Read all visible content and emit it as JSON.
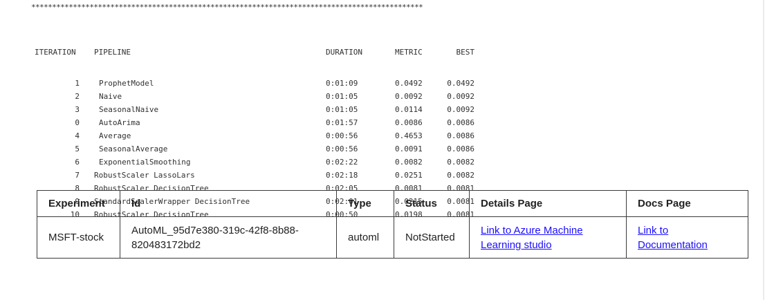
{
  "output": {
    "separator": "**********************************************************************************************",
    "headers": {
      "iteration": "ITERATION",
      "pipeline": "PIPELINE",
      "duration": "DURATION",
      "metric": "METRIC",
      "best": "BEST"
    },
    "runs": [
      {
        "iteration": "1",
        "pipeline": "ProphetModel",
        "duration": "0:01:09",
        "metric": "0.0492",
        "best": "0.0492"
      },
      {
        "iteration": "2",
        "pipeline": "Naive",
        "duration": "0:01:05",
        "metric": "0.0092",
        "best": "0.0092"
      },
      {
        "iteration": "3",
        "pipeline": "SeasonalNaive",
        "duration": "0:01:05",
        "metric": "0.0114",
        "best": "0.0092"
      },
      {
        "iteration": "0",
        "pipeline": "AutoArima",
        "duration": "0:01:57",
        "metric": "0.0086",
        "best": "0.0086"
      },
      {
        "iteration": "4",
        "pipeline": "Average",
        "duration": "0:00:56",
        "metric": "0.4653",
        "best": "0.0086"
      },
      {
        "iteration": "5",
        "pipeline": "SeasonalAverage",
        "duration": "0:00:56",
        "metric": "0.0091",
        "best": "0.0086"
      },
      {
        "iteration": "6",
        "pipeline": "ExponentialSmoothing",
        "duration": "0:02:22",
        "metric": "0.0082",
        "best": "0.0082"
      },
      {
        "iteration": "7",
        "pipeline": "RobustScaler LassoLars",
        "duration": "0:02:18",
        "metric": "0.0251",
        "best": "0.0082"
      },
      {
        "iteration": "8",
        "pipeline": "RobustScaler DecisionTree",
        "duration": "0:02:05",
        "metric": "0.0081",
        "best": "0.0081"
      },
      {
        "iteration": "9",
        "pipeline": "StandardScalerWrapper DecisionTree",
        "duration": "0:02:01",
        "metric": "0.0215",
        "best": "0.0081"
      },
      {
        "iteration": "10",
        "pipeline": "RobustScaler DecisionTree",
        "duration": "0:00:50",
        "metric": "0.0198",
        "best": "0.0081"
      }
    ]
  },
  "experiment_table": {
    "headers": [
      "Experiment",
      "Id",
      "Type",
      "Status",
      "Details Page",
      "Docs Page"
    ],
    "row": {
      "experiment": "MSFT-stock",
      "id": "AutoML_95d7e380-319c-42f8-8b88-820483172bd2",
      "type": "automl",
      "status": "NotStarted",
      "details_link": "Link to Azure Machine Learning studio",
      "docs_link": "Link to Documentation"
    }
  },
  "colors": {
    "link": "#1a0dff",
    "text": "#212121",
    "border": "#3a3a3a"
  }
}
